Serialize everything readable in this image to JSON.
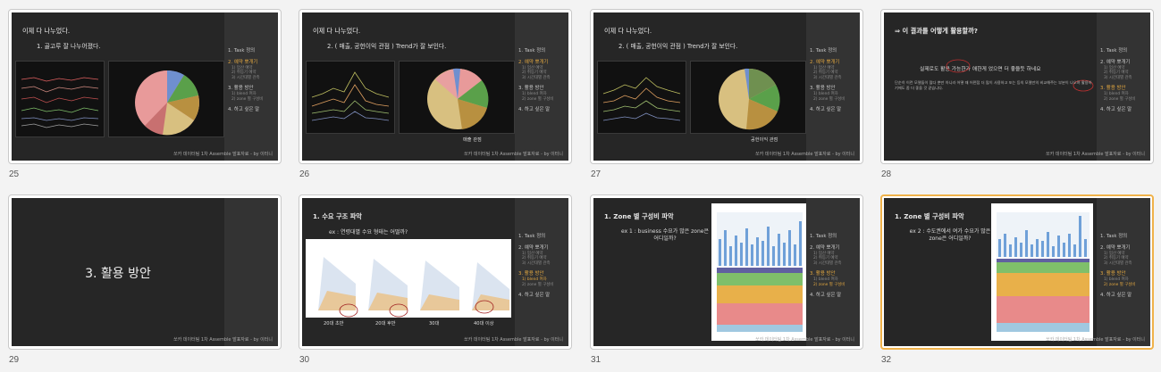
{
  "deck": {
    "footer": "쏘카 데이터팀 1차 Assemble 발표자료 - by 이터니",
    "sidebar": {
      "items": [
        {
          "label": "1. Task 정의"
        },
        {
          "label": "2. 예약 뽀개기",
          "subs": [
            "1) 업산 예약",
            "2) 취등기 예약",
            "3) 시간대별 관측"
          ]
        },
        {
          "label": "3. 활용 방안",
          "subs": [
            "1) blend 여자",
            "2) zone 별 구성비"
          ]
        },
        {
          "label": "4. 하고 싶은 말"
        }
      ]
    }
  },
  "slides": [
    {
      "number": "25",
      "title": "이제 다 나누었다.",
      "subtitle": "1. 골고루 잘 나누어졌다.",
      "caption": ""
    },
    {
      "number": "26",
      "title": "이제 다 나누었다.",
      "subtitle": "2. ( 매출, 공헌이익 관점 ) Trend가 잘 보인다.",
      "caption": "매출 관점"
    },
    {
      "number": "27",
      "title": "이제 다 나누었다.",
      "subtitle": "2. ( 매출, 공헌이익 관점 ) Trend가 잘 보인다.",
      "caption": "공헌이익 관점"
    },
    {
      "number": "28",
      "title": "⇒ 이 결과를 어떻게 활용할까?",
      "subtitle": "실제로도 활용 가능한가 애한게 었으면 더 좋을듯 하네요",
      "body": "단순히 이런 모델들이 많다 뿐만 아니라 어떻 때 어떤점 더 많이 사용하고 또는 등의 모델만의 비교해주는 부분이 나오며 활용하기에도 좀 더 좋을 것 같습니다."
    },
    {
      "number": "29",
      "title": "3. 활용 방안"
    },
    {
      "number": "30",
      "title": "1.  수요 구조 파악",
      "subtitle": "ex : 연령대별 수요 형태는 어떨까?",
      "labels": [
        "20대 초반",
        "20대 후반",
        "30대",
        "40대 이상"
      ]
    },
    {
      "number": "31",
      "title": "1.  Zone 별 구성비 파악",
      "subtitle": "ex 1 : business 수요가 많은 zone은 어디일까?"
    },
    {
      "number": "32",
      "title": "1.  Zone 별 구성비 파악",
      "subtitle": "ex 2 : 수도권에서 여가 수요가 많은 zone은 어디일까?"
    }
  ]
}
